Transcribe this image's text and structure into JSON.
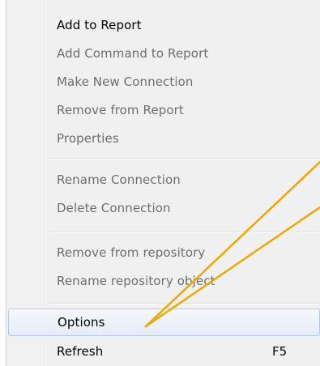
{
  "context_menu": {
    "groups": [
      {
        "items": [
          {
            "label": "Add to Report",
            "enabled": true
          },
          {
            "label": "Add Command to Report",
            "enabled": false
          },
          {
            "label": "Make New Connection",
            "enabled": false
          },
          {
            "label": "Remove from Report",
            "enabled": false
          },
          {
            "label": "Properties",
            "enabled": false
          }
        ]
      },
      {
        "items": [
          {
            "label": "Rename Connection",
            "enabled": false
          },
          {
            "label": "Delete Connection",
            "enabled": false
          }
        ]
      },
      {
        "items": [
          {
            "label": "Remove from repository",
            "enabled": false
          },
          {
            "label": "Rename repository object",
            "enabled": false
          }
        ]
      },
      {
        "items": [
          {
            "label": "Options",
            "enabled": true,
            "highlighted": true
          },
          {
            "label": "Refresh",
            "enabled": true,
            "shortcut": "F5"
          }
        ]
      }
    ]
  },
  "annotation": {
    "color": "#f0a800"
  }
}
